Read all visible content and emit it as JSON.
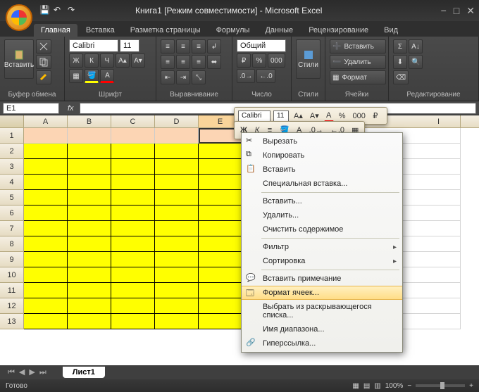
{
  "title": "Книга1  [Режим совместимости] - Microsoft Excel",
  "qat": {
    "save": "💾",
    "undo": "↶",
    "redo": "↷"
  },
  "tabs": [
    "Главная",
    "Вставка",
    "Разметка страницы",
    "Формулы",
    "Данные",
    "Рецензирование",
    "Вид"
  ],
  "active_tab": 0,
  "ribbon": {
    "clipboard": {
      "paste": "Вставить",
      "label": "Буфер обмена"
    },
    "font": {
      "name": "Calibri",
      "size": "11",
      "label": "Шрифт",
      "bold": "Ж",
      "italic": "К",
      "underline": "Ч"
    },
    "alignment": {
      "label": "Выравнивание"
    },
    "number": {
      "format": "Общий",
      "label": "Число",
      "percent": "%",
      "comma": "000"
    },
    "styles": {
      "btn": "Стили",
      "label": "Стили"
    },
    "cells": {
      "insert": "Вставить",
      "delete": "Удалить",
      "format": "Формат",
      "label": "Ячейки"
    },
    "editing": {
      "sigma": "Σ",
      "label": "Редактирование"
    }
  },
  "formula": {
    "namebox": "E1",
    "fx": "fx"
  },
  "mini": {
    "font": "Calibri",
    "size": "11",
    "grow": "A▴",
    "shrink": "A▾",
    "bold": "Ж",
    "italic": "К",
    "pct": "%",
    "comma": "000"
  },
  "columns": [
    "A",
    "B",
    "C",
    "D",
    "E",
    "I"
  ],
  "rows": [
    1,
    2,
    3,
    4,
    5,
    6,
    7,
    8,
    9,
    10,
    11,
    12,
    13
  ],
  "context": {
    "cut": "Вырезать",
    "copy": "Копировать",
    "paste": "Вставить",
    "paste_special": "Специальная вставка...",
    "insert": "Вставить...",
    "delete": "Удалить...",
    "clear": "Очистить содержимое",
    "filter": "Фильтр",
    "sort": "Сортировка",
    "comment": "Вставить примечание",
    "format_cells": "Формат ячеек...",
    "dropdown": "Выбрать из раскрывающегося списка...",
    "name": "Имя диапазона...",
    "hyperlink": "Гиперссылка..."
  },
  "sheet_tab": "Лист1",
  "status": {
    "ready": "Готово",
    "zoom": "100%"
  },
  "colors": {
    "yellow": "#ffff00",
    "peach": "#fcd5b4"
  }
}
